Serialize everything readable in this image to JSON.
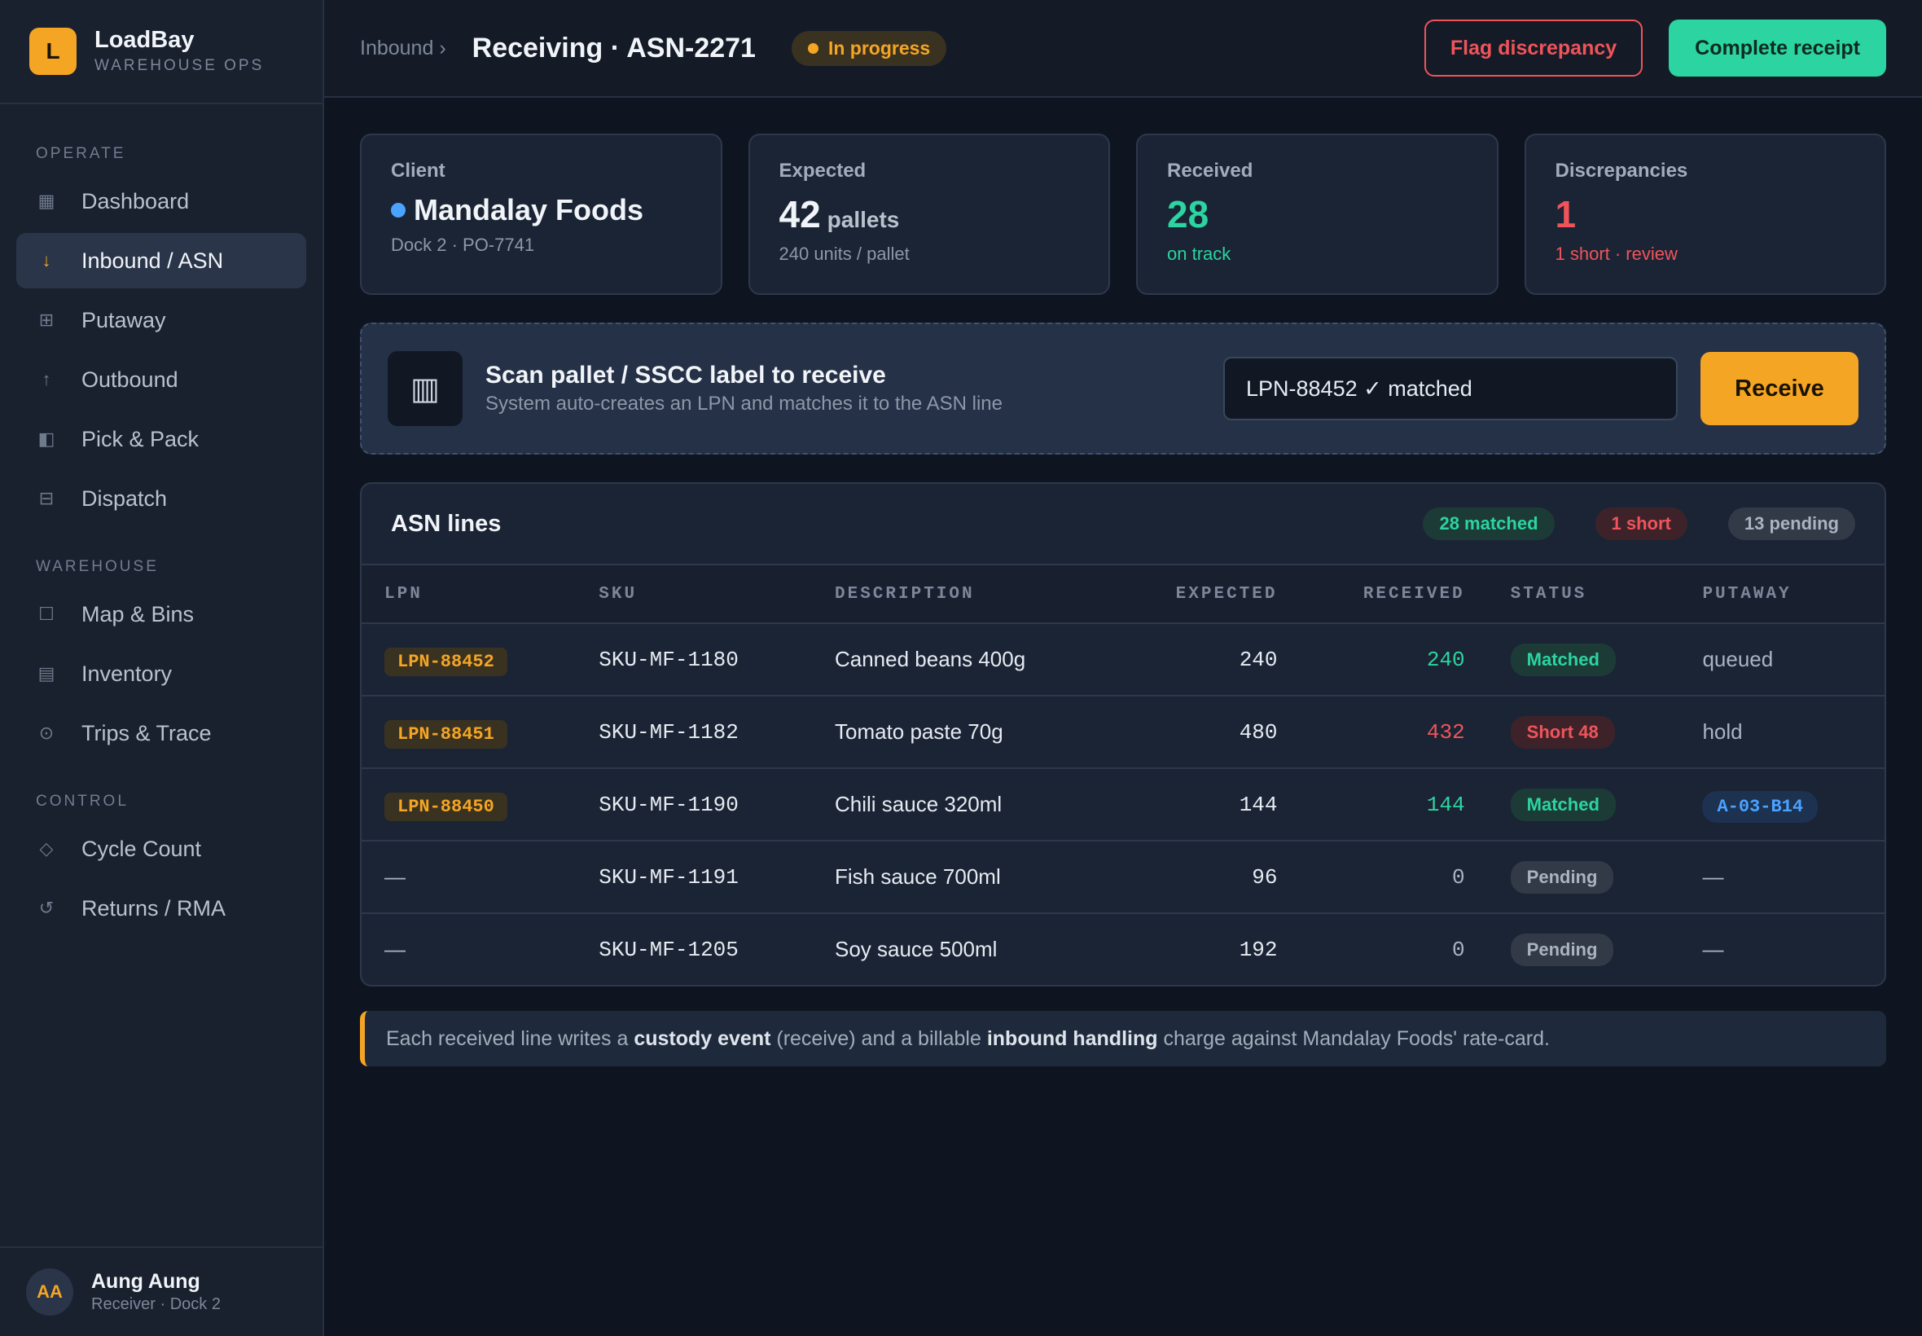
{
  "brand": {
    "logo": "L",
    "name": "LoadBay",
    "subtitle": "WAREHOUSE OPS"
  },
  "sidebar": {
    "sections": [
      {
        "title": "OPERATE",
        "items": [
          {
            "label": "Dashboard",
            "icon": "dashboard-icon",
            "glyph": "▦"
          },
          {
            "label": "Inbound / ASN",
            "icon": "arrow-down-icon",
            "glyph": "↓",
            "active": true
          },
          {
            "label": "Putaway",
            "icon": "grid-icon",
            "glyph": "⊞"
          },
          {
            "label": "Outbound",
            "icon": "arrow-up-icon",
            "glyph": "↑"
          },
          {
            "label": "Pick & Pack",
            "icon": "pick-icon",
            "glyph": "◧"
          },
          {
            "label": "Dispatch",
            "icon": "dispatch-icon",
            "glyph": "⊟"
          }
        ]
      },
      {
        "title": "WAREHOUSE",
        "items": [
          {
            "label": "Map & Bins",
            "icon": "map-icon",
            "glyph": "☐"
          },
          {
            "label": "Inventory",
            "icon": "inventory-icon",
            "glyph": "▤"
          },
          {
            "label": "Trips & Trace",
            "icon": "trace-icon",
            "glyph": "⊙"
          }
        ]
      },
      {
        "title": "CONTROL",
        "items": [
          {
            "label": "Cycle Count",
            "icon": "diamond-icon",
            "glyph": "◇"
          },
          {
            "label": "Returns / RMA",
            "icon": "return-icon",
            "glyph": "↺"
          }
        ]
      }
    ]
  },
  "user": {
    "initials": "AA",
    "name": "Aung Aung",
    "role": "Receiver · Dock 2"
  },
  "header": {
    "breadcrumb": "Inbound ›",
    "title": "Receiving · ASN-2271",
    "status": "In progress",
    "flag_label": "Flag discrepancy",
    "complete_label": "Complete receipt"
  },
  "cards": {
    "client": {
      "label": "Client",
      "value": "Mandalay Foods",
      "sub": "Dock 2 · PO-7741"
    },
    "expected": {
      "label": "Expected",
      "value": "42",
      "unit": "pallets",
      "sub": "240 units / pallet"
    },
    "received": {
      "label": "Received",
      "value": "28",
      "sub": "on track"
    },
    "discrepancies": {
      "label": "Discrepancies",
      "value": "1",
      "sub": "1 short · review"
    }
  },
  "scan": {
    "glyph": "▥",
    "title": "Scan pallet / SSCC label to receive",
    "subtitle": "System auto-creates an LPN and matches it to the ASN line",
    "value": "LPN-88452 ✓ matched",
    "button": "Receive"
  },
  "table": {
    "title": "ASN lines",
    "badges": {
      "matched": "28 matched",
      "short": "1 short",
      "pending": "13 pending"
    },
    "columns": [
      "LPN",
      "SKU",
      "DESCRIPTION",
      "EXPECTED",
      "RECEIVED",
      "STATUS",
      "PUTAWAY"
    ],
    "rows": [
      {
        "lpn": "LPN-88452",
        "sku": "SKU-MF-1180",
        "desc": "Canned beans 400g",
        "expected": "240",
        "received": "240",
        "status": "Matched",
        "putaway": "queued"
      },
      {
        "lpn": "LPN-88451",
        "sku": "SKU-MF-1182",
        "desc": "Tomato paste 70g",
        "expected": "480",
        "received": "432",
        "status": "Short 48",
        "putaway": "hold"
      },
      {
        "lpn": "LPN-88450",
        "sku": "SKU-MF-1190",
        "desc": "Chili sauce 320ml",
        "expected": "144",
        "received": "144",
        "status": "Matched",
        "putaway": "A-03-B14"
      },
      {
        "lpn": "—",
        "sku": "SKU-MF-1191",
        "desc": "Fish sauce 700ml",
        "expected": "96",
        "received": "0",
        "status": "Pending",
        "putaway": "—"
      },
      {
        "lpn": "—",
        "sku": "SKU-MF-1205",
        "desc": "Soy sauce 500ml",
        "expected": "192",
        "received": "0",
        "status": "Pending",
        "putaway": "—"
      }
    ]
  },
  "note": {
    "p1": "Each received line writes a ",
    "b1": "custody event",
    "p2": " (receive) and a billable ",
    "b2": "inbound handling",
    "p3": " charge against Mandalay Foods' rate-card."
  }
}
